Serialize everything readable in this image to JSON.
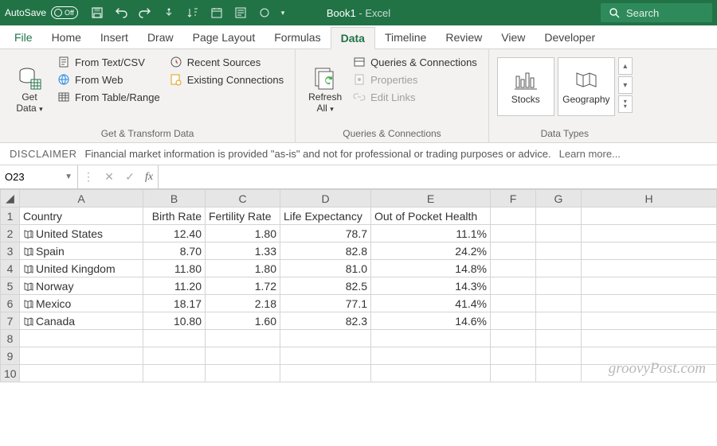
{
  "titlebar": {
    "autosave_label": "AutoSave",
    "autosave_state": "Off",
    "doc_name": "Book1",
    "app_suffix": " - Excel",
    "search_placeholder": "Search"
  },
  "tabs": [
    "File",
    "Home",
    "Insert",
    "Draw",
    "Page Layout",
    "Formulas",
    "Data",
    "Timeline",
    "Review",
    "View",
    "Developer"
  ],
  "active_tab": "Data",
  "ribbon": {
    "get_data": {
      "big": "Get\nData",
      "items": [
        "From Text/CSV",
        "From Web",
        "From Table/Range"
      ],
      "label": "Get & Transform Data"
    },
    "recent": {
      "items": [
        "Recent Sources",
        "Existing Connections"
      ]
    },
    "refresh": {
      "big": "Refresh\nAll",
      "items": [
        "Queries & Connections",
        "Properties",
        "Edit Links"
      ],
      "label": "Queries & Connections"
    },
    "datatypes": {
      "cards": [
        "Stocks",
        "Geography"
      ],
      "label": "Data Types"
    }
  },
  "disclaimer": {
    "tag": "DISCLAIMER",
    "text": "Financial market information is provided \"as-is\" and not for professional or trading purposes or advice.",
    "learn": "Learn more..."
  },
  "namebox": "O23",
  "fx": "fx",
  "columns": [
    "A",
    "B",
    "C",
    "D",
    "E",
    "F",
    "G",
    "H"
  ],
  "headers": {
    "A": "Country",
    "B": "Birth Rate",
    "C": "Fertility Rate",
    "D": "Life Expectancy",
    "E": "Out of Pocket Health"
  },
  "rows": [
    {
      "A": "United States",
      "B": "12.40",
      "C": "1.80",
      "D": "78.7",
      "E": "11.1%"
    },
    {
      "A": "Spain",
      "B": "8.70",
      "C": "1.33",
      "D": "82.8",
      "E": "24.2%"
    },
    {
      "A": "United Kingdom",
      "B": "11.80",
      "C": "1.80",
      "D": "81.0",
      "E": "14.8%"
    },
    {
      "A": "Norway",
      "B": "11.20",
      "C": "1.72",
      "D": "82.5",
      "E": "14.3%"
    },
    {
      "A": "Mexico",
      "B": "18.17",
      "C": "2.18",
      "D": "77.1",
      "E": "41.4%"
    },
    {
      "A": "Canada",
      "B": "10.80",
      "C": "1.60",
      "D": "82.3",
      "E": "14.6%"
    }
  ],
  "empty_rows": [
    8,
    9,
    10
  ],
  "watermark": "groovyPost.com"
}
